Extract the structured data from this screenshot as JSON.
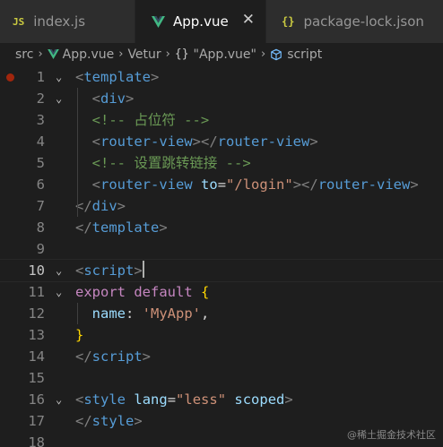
{
  "tabs": [
    {
      "badge": "JS",
      "label": "index.js"
    },
    {
      "label": "App.vue",
      "close": "✕"
    },
    {
      "badge": "{}",
      "label": "package-lock.json"
    }
  ],
  "breadcrumb": {
    "items": [
      "src",
      "App.vue",
      "Vetur",
      "\"App.vue\"",
      "script"
    ],
    "braces": "{}",
    "sep": "›"
  },
  "editor": {
    "line_numbers": [
      "1",
      "2",
      "3",
      "4",
      "5",
      "6",
      "7",
      "8",
      "9",
      "10",
      "11",
      "12",
      "13",
      "14",
      "15",
      "16",
      "17",
      "18"
    ],
    "current_line": "10",
    "lines": [
      {
        "tokens": [
          [
            "c-punct",
            "<"
          ],
          [
            "c-tag",
            "template"
          ],
          [
            "c-punct",
            ">"
          ]
        ]
      },
      {
        "tokens": [
          [
            "c-plain",
            "  "
          ],
          [
            "c-punct",
            "<"
          ],
          [
            "c-tag",
            "div"
          ],
          [
            "c-punct",
            ">"
          ]
        ]
      },
      {
        "tokens": [
          [
            "c-plain",
            "  "
          ],
          [
            "c-comment",
            "<!-- 占位符 -->"
          ]
        ]
      },
      {
        "tokens": [
          [
            "c-plain",
            "  "
          ],
          [
            "c-punct",
            "<"
          ],
          [
            "c-tag",
            "router-view"
          ],
          [
            "c-punct",
            "></"
          ],
          [
            "c-tag",
            "router-view"
          ],
          [
            "c-punct",
            ">"
          ]
        ]
      },
      {
        "tokens": [
          [
            "c-plain",
            "  "
          ],
          [
            "c-comment",
            "<!-- 设置跳转链接 -->"
          ]
        ]
      },
      {
        "tokens": [
          [
            "c-plain",
            "  "
          ],
          [
            "c-punct",
            "<"
          ],
          [
            "c-tag",
            "router-view"
          ],
          [
            "c-plain",
            " "
          ],
          [
            "c-attr",
            "to"
          ],
          [
            "c-plain",
            "="
          ],
          [
            "c-str",
            "\"/login\""
          ],
          [
            "c-punct",
            "></"
          ],
          [
            "c-tag",
            "router-view"
          ],
          [
            "c-punct",
            ">"
          ]
        ]
      },
      {
        "tokens": [
          [
            "c-punct",
            "</"
          ],
          [
            "c-tag",
            "div"
          ],
          [
            "c-punct",
            ">"
          ]
        ]
      },
      {
        "tokens": [
          [
            "c-punct",
            "</"
          ],
          [
            "c-tag",
            "template"
          ],
          [
            "c-punct",
            ">"
          ]
        ]
      },
      {
        "tokens": []
      },
      {
        "tokens": [
          [
            "c-punct",
            "<"
          ],
          [
            "c-tag",
            "script"
          ],
          [
            "c-punct",
            ">"
          ]
        ]
      },
      {
        "tokens": [
          [
            "c-kw",
            "export"
          ],
          [
            "c-plain",
            " "
          ],
          [
            "c-kw",
            "default"
          ],
          [
            "c-plain",
            " "
          ],
          [
            "c-brace",
            "{"
          ]
        ]
      },
      {
        "tokens": [
          [
            "c-plain",
            "  "
          ],
          [
            "c-attr",
            "name"
          ],
          [
            "c-plain",
            ": "
          ],
          [
            "c-str",
            "'MyApp'"
          ],
          [
            "c-plain",
            ","
          ]
        ]
      },
      {
        "tokens": [
          [
            "c-brace",
            "}"
          ]
        ]
      },
      {
        "tokens": [
          [
            "c-punct",
            "</"
          ],
          [
            "c-tag",
            "script"
          ],
          [
            "c-punct",
            ">"
          ]
        ]
      },
      {
        "tokens": []
      },
      {
        "tokens": [
          [
            "c-punct",
            "<"
          ],
          [
            "c-tag",
            "style"
          ],
          [
            "c-plain",
            " "
          ],
          [
            "c-attr",
            "lang"
          ],
          [
            "c-plain",
            "="
          ],
          [
            "c-str",
            "\"less\""
          ],
          [
            "c-plain",
            " "
          ],
          [
            "c-attr",
            "scoped"
          ],
          [
            "c-punct",
            ">"
          ]
        ]
      },
      {
        "tokens": [
          [
            "c-punct",
            "</"
          ],
          [
            "c-tag",
            "style"
          ],
          [
            "c-punct",
            ">"
          ]
        ]
      },
      {
        "tokens": []
      }
    ]
  },
  "watermark": "@稀土掘金技术社区",
  "colors": {
    "vue_green": "#41b883",
    "vue_dark": "#34495e",
    "breakpoint": "#a1260d"
  }
}
